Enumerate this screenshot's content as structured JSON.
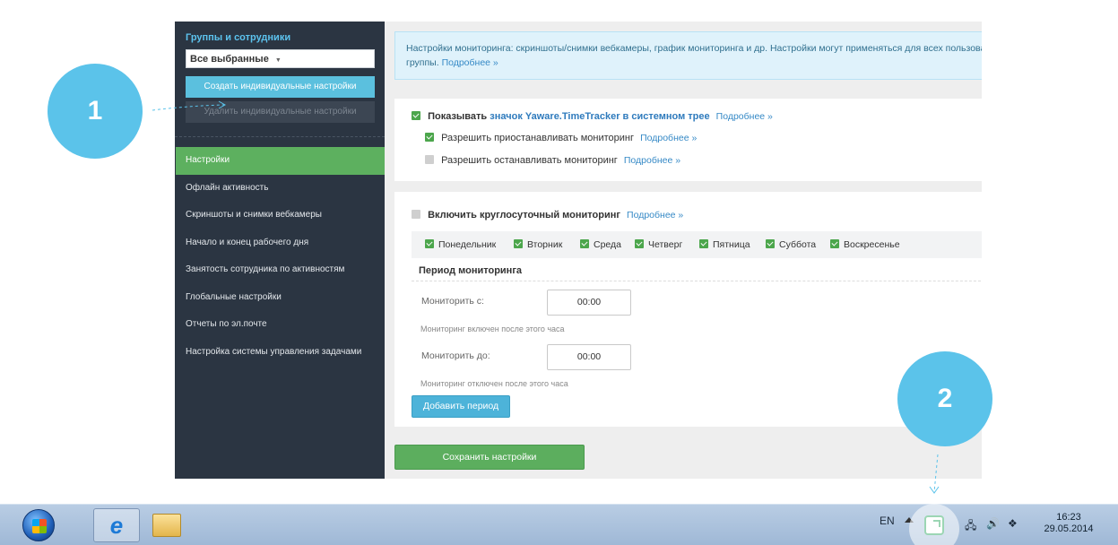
{
  "sidebar": {
    "title": "Группы и сотрудники",
    "select_value": "Все выбранные",
    "create_button": "Создать индивидуальные настройки",
    "delete_button": "Удалить индивидуальные настройки",
    "items": [
      {
        "label": "Настройки",
        "active": true
      },
      {
        "label": "Офлайн активность"
      },
      {
        "label": "Скриншоты и снимки вебкамеры"
      },
      {
        "label": "Начало и конец рабочего дня"
      },
      {
        "label": "Занятость сотрудника по активностям"
      },
      {
        "label": "Глобальные настройки"
      },
      {
        "label": "Отчеты по эл.почте"
      },
      {
        "label": "Настройка системы управления задачами"
      }
    ]
  },
  "info": {
    "text": "Настройки мониторинга: скриншоты/снимки вебкамеры, график мониторинга и др. Настройки могут применяться для всех пользователя/группы.",
    "link": "Подробнее »"
  },
  "tray_section": {
    "show_prefix": "Показывать",
    "show_accent": "значок Yaware.TimeTracker в системном трее",
    "show_link": "Подробнее »",
    "pause_label": "Разрешить приостанавливать мониторинг",
    "pause_link": "Подробнее »",
    "stop_label": "Разрешить останавливать мониторинг",
    "stop_link": "Подробнее »"
  },
  "monitoring": {
    "enable_label": "Включить круглосуточный мониторинг",
    "enable_link": "Подробнее »",
    "days": [
      "Понедельник",
      "Вторник",
      "Среда",
      "Четверг",
      "Пятница",
      "Суббота",
      "Воскресенье"
    ],
    "period_title": "Период мониторинга",
    "from_label": "Мониторить с:",
    "from_value": "00:00",
    "from_hint": "Мониторинг включен после этого часа",
    "to_label": "Мониторить до:",
    "to_value": "00:00",
    "to_hint": "Мониторинг отключен после этого часа",
    "add_button": "Добавить период"
  },
  "save_button": "Сохранить настройки",
  "callouts": {
    "one": "1",
    "two": "2"
  },
  "taskbar": {
    "ie_glyph": "e",
    "language": "EN",
    "time": "16:23",
    "date": "29.05.2014"
  },
  "colors": {
    "sidebar_bg": "#2b3542",
    "active_item": "#5db05f",
    "accent_blue": "#5bc3ea",
    "checkbox_green": "#4ca64c"
  }
}
